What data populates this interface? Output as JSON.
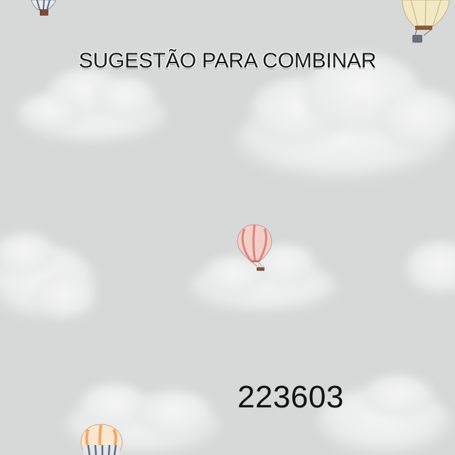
{
  "headline": "SUGESTÃO PARA COMBINAR",
  "product_code": "223603",
  "colors": {
    "sky": "#d7d9d8",
    "cloud": "#ececec",
    "balloon_pink": "#e9a9a3",
    "balloon_cream": "#f3e8c4",
    "balloon_orange": "#f0a86a"
  },
  "icons": [
    "hot-air-balloon-icon",
    "cloud-icon"
  ]
}
